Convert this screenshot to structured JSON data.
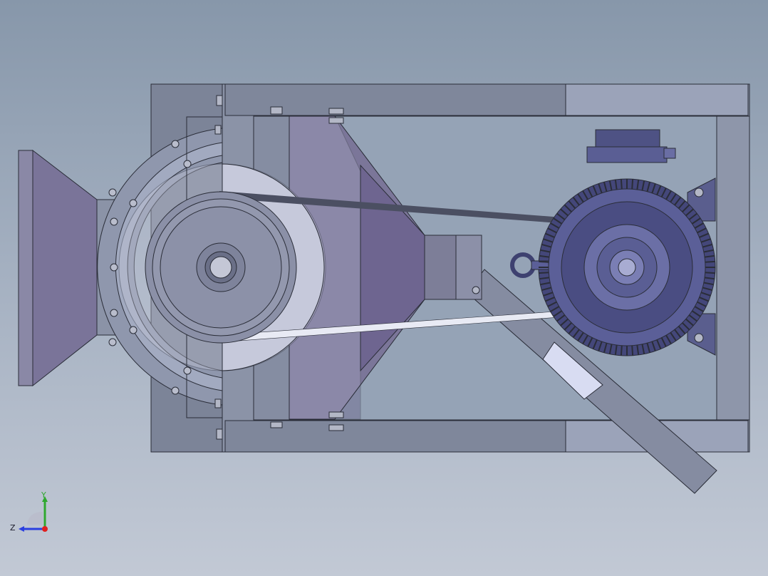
{
  "viewport": {
    "background_top": "#8797aa",
    "background_bottom": "#c2c9d5"
  },
  "triad": {
    "y_label": "Y",
    "z_label": "Z",
    "y_color": "#2fa82f",
    "z_color": "#2a3fe0",
    "x_color": "#e02020"
  },
  "colors": {
    "frame": "#7e8699",
    "frame_light": "#9aa1b7",
    "edge": "#2a2d38",
    "hopper": "#786c94",
    "hopper_dark": "#5f5680",
    "pulley": "#8a8fa6",
    "motor": "#565a90",
    "motor_dark": "#3e4170",
    "belt": "#4b4f62",
    "highlight": "#d8dcf2"
  }
}
